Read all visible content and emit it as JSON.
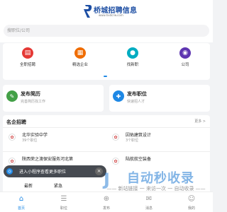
{
  "header": {
    "logo_text": "桥城招聘信息",
    "logo_subtext": "www.hxdcrw.com",
    "search_placeholder": "搜职位/公司"
  },
  "nav": [
    {
      "label": "全职招聘",
      "icon": "briefcase-icon",
      "color": "#e53935"
    },
    {
      "label": "精选企业",
      "icon": "building-icon",
      "color": "#ef6c00"
    },
    {
      "label": "找新职",
      "icon": "person-icon",
      "color": "#00acc1"
    },
    {
      "label": "公司",
      "icon": "user-circle-icon",
      "color": "#5e35b1"
    }
  ],
  "cards": [
    {
      "title": "发布简历",
      "sub": "完善简历找工作",
      "icon": "resume-icon",
      "color": "#43a047"
    },
    {
      "title": "发布职位",
      "sub": "快速招人才",
      "icon": "post-icon",
      "color": "#1e88e5"
    }
  ],
  "companies": {
    "title": "名企招聘",
    "more": "更多 >",
    "items": [
      {
        "name": "北华实验中学",
        "jobs": "39个职位"
      },
      {
        "name": "因佑建筑设计",
        "jobs": "3个职位"
      },
      {
        "name": "陕西荣之澳保安服务河北第",
        "jobs": ""
      },
      {
        "name": "陆航航空装备",
        "jobs": ""
      }
    ]
  },
  "popup": {
    "text": "进入小程序查看更多职位",
    "close": "×"
  },
  "sub_tabs": [
    "最新",
    "紧急"
  ],
  "watermark": {
    "text": "自动秒收录",
    "subtext": "—— 新站链接 一 来访一次 一 自动收录 ——"
  },
  "tabbar": [
    {
      "label": "首页",
      "icon": "home-icon",
      "active": true
    },
    {
      "label": "职位",
      "icon": "list-icon",
      "active": false
    },
    {
      "label": "发布",
      "icon": "plus-icon",
      "active": false
    },
    {
      "label": "消息",
      "icon": "message-icon",
      "active": false
    },
    {
      "label": "我的",
      "icon": "profile-icon",
      "active": false
    }
  ]
}
